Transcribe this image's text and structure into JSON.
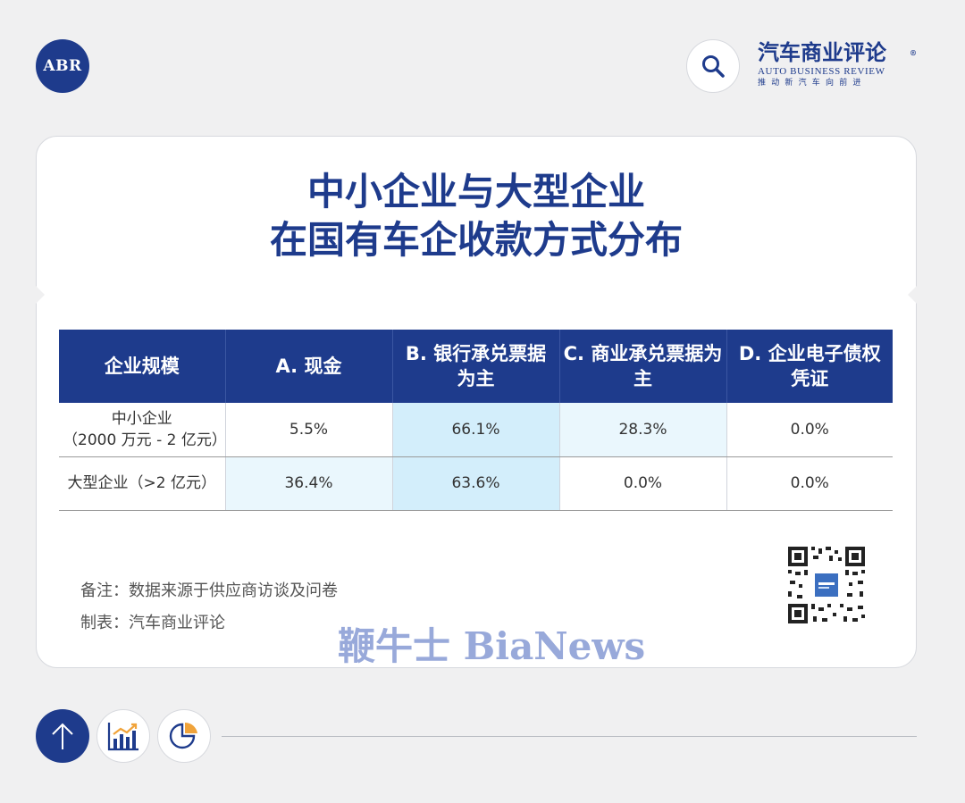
{
  "header": {
    "left_logo_text": "ABR",
    "brand_cn": "汽车商业评论",
    "brand_reg": "®",
    "brand_en": "AUTO BUSINESS REVIEW",
    "brand_slogan": "推动新汽车向前进"
  },
  "card": {
    "title_line1": "中小企业与大型企业",
    "title_line2": "在国有车企收款方式分布"
  },
  "table": {
    "headers": [
      "企业规模",
      "A. 现金",
      "B. 银行承兑票据为主",
      "C. 商业承兑票据为主",
      "D. 企业电子债权凭证"
    ],
    "rows": [
      {
        "scale_line1": "中小企业",
        "scale_line2": "（2000 万元 - 2 亿元）",
        "values": [
          "5.5%",
          "66.1%",
          "28.3%",
          "0.0%"
        ]
      },
      {
        "scale_line1": "大型企业（>2 亿元）",
        "values": [
          "36.4%",
          "63.6%",
          "0.0%",
          "0.0%"
        ]
      }
    ]
  },
  "notes": {
    "remark": "备注：数据来源于供应商访谈及问卷",
    "made_by": "制表：汽车商业评论"
  },
  "watermark": "鞭牛士 BiaNews",
  "colors": {
    "brand_blue": "#1e3b8c",
    "highlight_strong": "#d3eefb",
    "highlight_light": "#eaf7fd",
    "watermark": "#8da0d6"
  },
  "icons": [
    "search-icon",
    "arrow-up-icon",
    "bar-chart-icon",
    "pie-chart-icon",
    "qr-code-icon"
  ]
}
